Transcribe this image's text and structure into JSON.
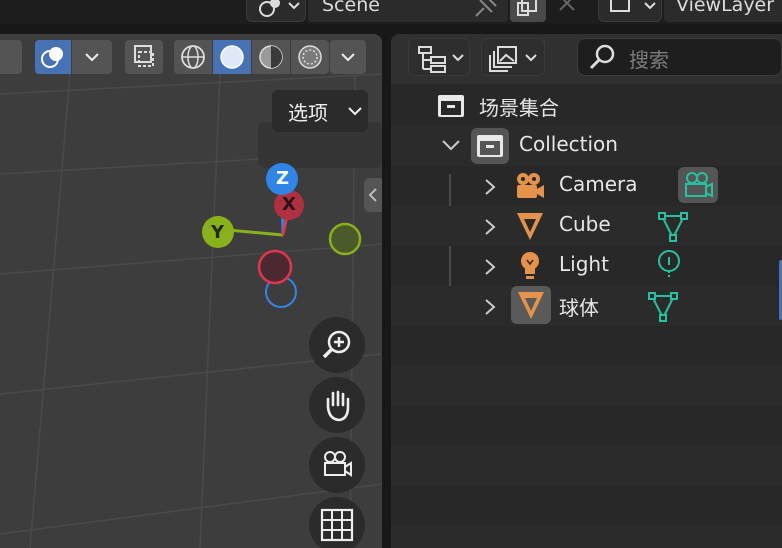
{
  "topbar": {
    "scene_label": "Scene",
    "view_layer_label": "ViewLayer"
  },
  "viewport": {
    "options_label": "选项",
    "gizmo": {
      "z": "Z",
      "x": "X",
      "y": "Y"
    },
    "nav_buttons": [
      "zoom-icon",
      "hand-pan-icon",
      "camera-view-icon",
      "grid-ortho-icon"
    ]
  },
  "outliner": {
    "search_placeholder": "搜索",
    "scene_collection": "场景集合",
    "collection": "Collection",
    "items": [
      {
        "label": "Camera",
        "type_icon": "camera-object-icon",
        "data_icon": "camera-data-icon"
      },
      {
        "label": "Cube",
        "type_icon": "mesh-object-icon",
        "data_icon": "mesh-data-icon"
      },
      {
        "label": "Light",
        "type_icon": "light-object-icon",
        "data_icon": "light-data-icon"
      },
      {
        "label": "球体",
        "type_icon": "mesh-object-icon",
        "data_icon": "mesh-data-icon"
      }
    ]
  },
  "colors": {
    "accent_blue": "#4772b3",
    "object_orange": "#e5924b",
    "data_green": "#25c2a0",
    "axis_x": "#e3344e",
    "axis_y": "#8ab01c",
    "axis_z": "#2f86e8"
  }
}
